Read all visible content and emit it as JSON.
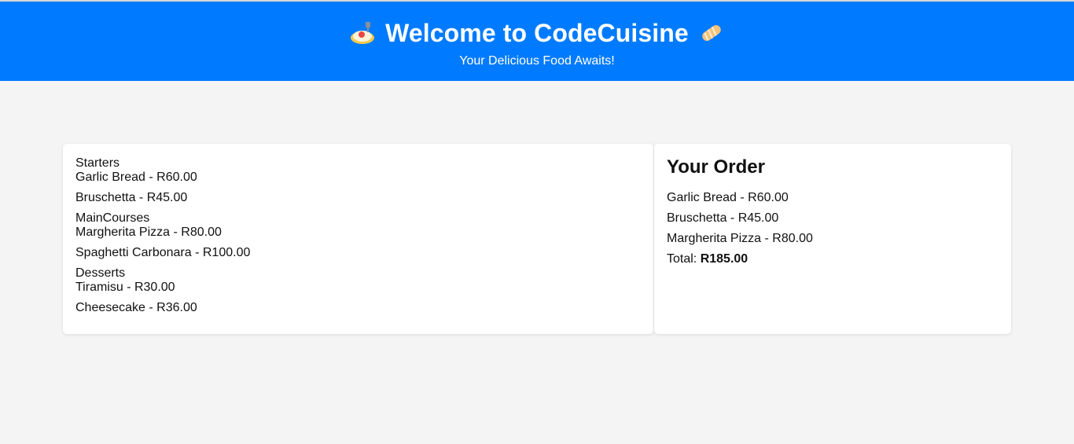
{
  "header": {
    "title": "Welcome to CodeCuisine",
    "subtitle": "Your Delicious Food Awaits!",
    "left_icon": "spaghetti-icon",
    "right_icon": "bread-icon",
    "background_color": "#007bff"
  },
  "menu": {
    "sections": [
      {
        "name": "Starters",
        "items": [
          "Garlic Bread - R60.00",
          "Bruschetta - R45.00"
        ]
      },
      {
        "name": "MainCourses",
        "items": [
          "Margherita Pizza - R80.00",
          "Spaghetti Carbonara - R100.00"
        ]
      },
      {
        "name": "Desserts",
        "items": [
          "Tiramisu - R30.00",
          "Cheesecake - R36.00"
        ]
      }
    ]
  },
  "order": {
    "title": "Your Order",
    "items": [
      "Garlic Bread - R60.00",
      "Bruschetta - R45.00",
      "Margherita Pizza - R80.00"
    ],
    "total_label": "Total:",
    "total_value": "R185.00"
  }
}
